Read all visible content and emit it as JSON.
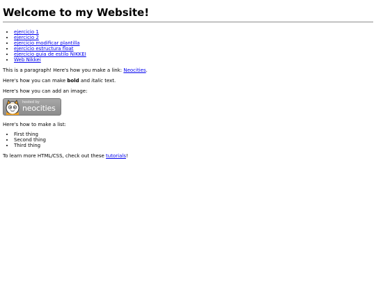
{
  "page": {
    "heading": "Welcome to my Website!"
  },
  "nav_links": [
    "ejercicio 1",
    "ejercicio 2",
    "ejercicio modificar plantilla",
    "ejercicio estructura float",
    "ejercicio guia de estilo NIKKEI",
    "Web Nikkei"
  ],
  "intro": {
    "text_before": "This is a paragraph! Here's how you make a link: ",
    "link_text": "Neocities",
    "text_after": "."
  },
  "formatting": {
    "text_before": "Here's how you can make ",
    "bold_text": "bold",
    "middle_text": " and ",
    "italic_text": "italic",
    "text_after": " text."
  },
  "image_section": {
    "text": "Here's how you can add an image:"
  },
  "badge": {
    "small_text": "hosted by",
    "big_text": "neocities"
  },
  "list_section": {
    "text": "Here's how to make a list:",
    "items": [
      "First thing",
      "Second thing",
      "Third thing"
    ]
  },
  "learn_more": {
    "text_before": "To learn more HTML/CSS, check out these ",
    "link_text": "tutorials",
    "text_after": "!"
  },
  "colors": {
    "link": "#0000ee",
    "badge_background": "#9a9a9a",
    "cat_orange": "#f0a020"
  }
}
